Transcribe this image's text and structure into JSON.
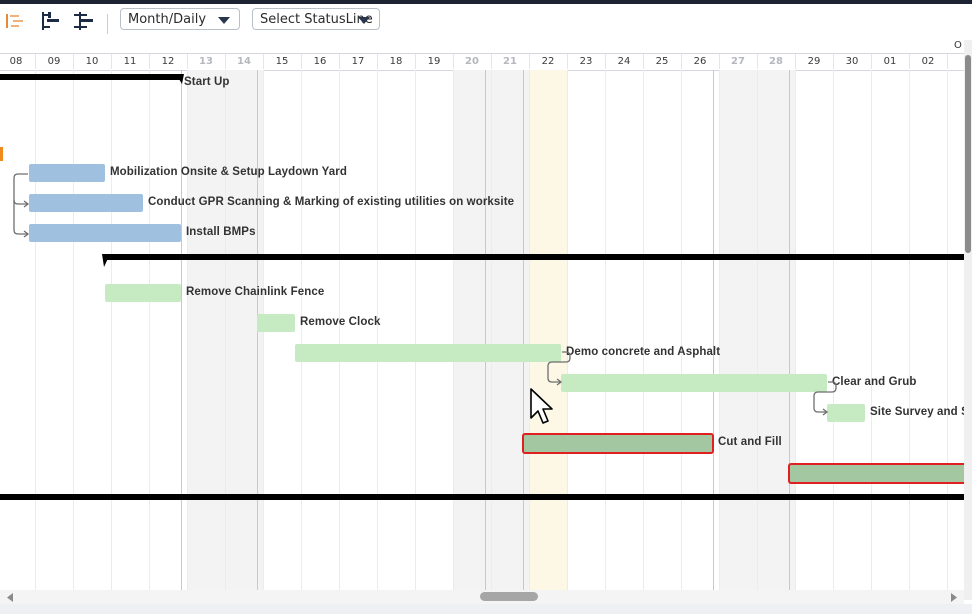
{
  "toolbar": {
    "icons": [
      "gantt-logo-icon",
      "indent-tree-icon",
      "outdent-tree-icon"
    ],
    "view_select": {
      "value": "Month/Daily"
    },
    "status_select": {
      "value": "Select StatusLine"
    }
  },
  "timeline": {
    "days": [
      "08",
      "09",
      "10",
      "11",
      "12",
      "13",
      "14",
      "15",
      "16",
      "17",
      "18",
      "19",
      "20",
      "21",
      "22",
      "23",
      "24",
      "25",
      "26",
      "27",
      "28",
      "29",
      "30",
      "01",
      "02"
    ],
    "weekend_days": [
      "13",
      "14",
      "20",
      "21",
      "27",
      "28"
    ],
    "today": "22",
    "header_right_glyph": "O"
  },
  "tasks": [
    {
      "name": "Start Up",
      "kind": "summary"
    },
    {
      "name": "Mobilization Onsite & Setup Laydown Yard",
      "color": "#9fc0de"
    },
    {
      "name": "Conduct GPR Scanning & Marking of existing utilities on worksite",
      "color": "#9fc0de"
    },
    {
      "name": "Install BMPs",
      "color": "#9fc0de"
    },
    {
      "name": "Remove Chainlink Fence",
      "color": "#c6ebc3"
    },
    {
      "name": "Remove Clock",
      "color": "#c6ebc3"
    },
    {
      "name": "Demo concrete and Asphalt",
      "color": "#c6ebc3"
    },
    {
      "name": "Clear and Grub",
      "color": "#c6ebc3"
    },
    {
      "name": "Site Survey and S",
      "color": "#c6ebc3"
    },
    {
      "name": "Cut and Fill",
      "color": "#a3c7a1",
      "critical": true
    },
    {
      "name": "",
      "color": "#a3c7a1",
      "critical": true
    }
  ],
  "colors": {
    "critical_border": "#e02020",
    "today_highlight": "#fdf8e6",
    "weekend_shade": "#f3f3f4",
    "accent_orange": "#f08a1c"
  }
}
